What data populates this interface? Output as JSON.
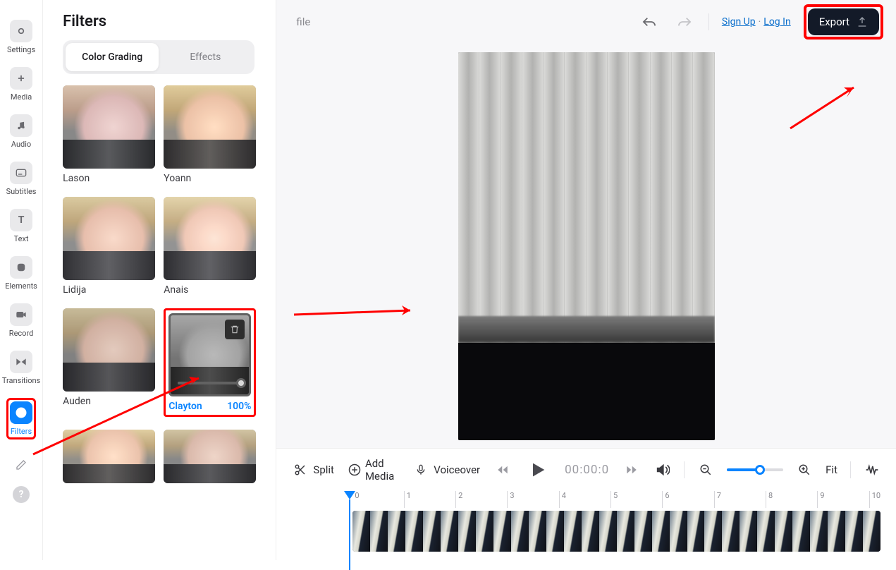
{
  "nav": {
    "items": [
      {
        "label": "Settings",
        "icon": "settings"
      },
      {
        "label": "Media",
        "icon": "plus"
      },
      {
        "label": "Audio",
        "icon": "note"
      },
      {
        "label": "Subtitles",
        "icon": "subtitles"
      },
      {
        "label": "Text",
        "icon": "text"
      },
      {
        "label": "Elements",
        "icon": "elements"
      },
      {
        "label": "Record",
        "icon": "record"
      },
      {
        "label": "Transitions",
        "icon": "transitions"
      },
      {
        "label": "Filters",
        "icon": "filters",
        "active": true
      },
      {
        "label": "",
        "icon": "pencil"
      },
      {
        "label": "",
        "icon": "help"
      }
    ]
  },
  "panel": {
    "title": "Filters",
    "tabs": {
      "a": "Color Grading",
      "b": "Effects"
    },
    "filters": [
      {
        "name": "Lason"
      },
      {
        "name": "Yoann"
      },
      {
        "name": "Lidija"
      },
      {
        "name": "Anais"
      },
      {
        "name": "Auden"
      },
      {
        "name": "Clayton",
        "selected": true,
        "pct": "100%"
      },
      {
        "name": ""
      },
      {
        "name": ""
      }
    ]
  },
  "top": {
    "file_label": "file",
    "signup": "Sign Up",
    "login": "Log In",
    "export": "Export"
  },
  "transport": {
    "split": "Split",
    "add_media": "Add Media",
    "voiceover": "Voiceover",
    "time": "00:00:0",
    "fit": "Fit"
  },
  "ruler": [
    "0",
    "1",
    "2",
    "3",
    "4",
    "5",
    "6",
    "7",
    "8",
    "9",
    "10"
  ]
}
